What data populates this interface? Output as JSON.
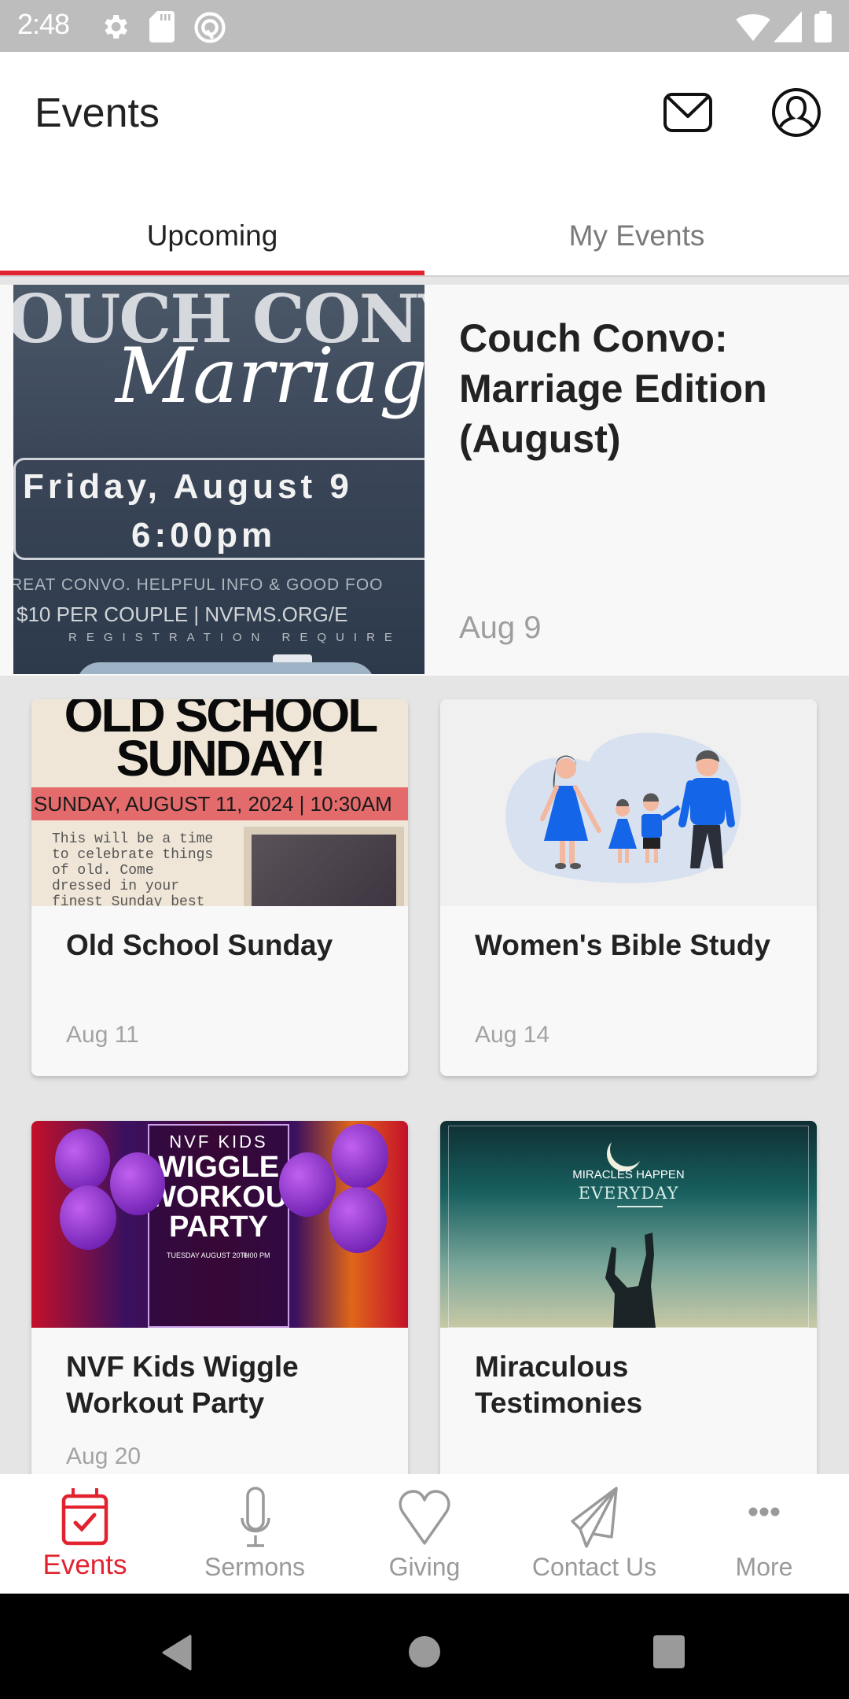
{
  "status_bar": {
    "time": "2:48",
    "left_icons": [
      "settings-gear-icon",
      "sd-card-icon",
      "at-sign-icon"
    ],
    "right_icons": [
      "wifi-icon",
      "cell-signal-icon",
      "battery-icon"
    ]
  },
  "header": {
    "title": "Events",
    "actions": [
      {
        "name": "messages",
        "icon": "mail-icon"
      },
      {
        "name": "profile",
        "icon": "user-circle-icon"
      }
    ]
  },
  "tabs": [
    {
      "label": "Upcoming",
      "active": true
    },
    {
      "label": "My Events",
      "active": false
    }
  ],
  "accent_color": "#e2222f",
  "featured_event": {
    "title": "Couch Convo: Marriage Edition (August)",
    "date": "Aug 9",
    "poster": {
      "heading": "OUCH CONV",
      "script": "Marriage Ed",
      "day": "Friday, August 9",
      "time": "6:00pm",
      "tagline": "REAT CONVO. HELPFUL INFO & GOOD FOO",
      "price": "$10 PER COUPLE | NVFMS.ORG/E",
      "note": "REGISTRATION REQUIRE"
    }
  },
  "events": [
    {
      "title": "Old School Sunday",
      "date": "Aug 11",
      "poster": {
        "heading1": "OLD SCHOOL",
        "heading2": "SUNDAY!",
        "banner": "SUNDAY, AUGUST 11, 2024 | 10:30AM",
        "body": "This will be a time\nto celebrate things\nof old. Come\ndressed in your\nfinest Sunday best"
      }
    },
    {
      "title": "Women's Bible Study",
      "date": "Aug 14",
      "poster": {
        "illustration": "family-illustration"
      }
    },
    {
      "title": "NVF Kids Wiggle Workout Party",
      "date": "Aug 20",
      "poster": {
        "line1": "NVF KIDS",
        "line2": "WIGGLE",
        "line3": "WORKOUT",
        "line4": "PARTY",
        "day": "TUESDAY AUGUST 20TH",
        "time": "6:00 PM"
      }
    },
    {
      "title": "Miraculous Testimonies",
      "date": "",
      "poster": {
        "line1": "MIRACLES HAPPEN",
        "line2": "EVERYDAY"
      }
    }
  ],
  "bottom_nav": [
    {
      "label": "Events",
      "icon": "calendar-check-icon",
      "active": true
    },
    {
      "label": "Sermons",
      "icon": "microphone-icon",
      "active": false
    },
    {
      "label": "Giving",
      "icon": "heart-icon",
      "active": false
    },
    {
      "label": "Contact Us",
      "icon": "paper-plane-icon",
      "active": false
    },
    {
      "label": "More",
      "icon": "more-dots-icon",
      "active": false
    }
  ],
  "system_nav": [
    "back-icon",
    "home-icon",
    "recents-icon"
  ]
}
